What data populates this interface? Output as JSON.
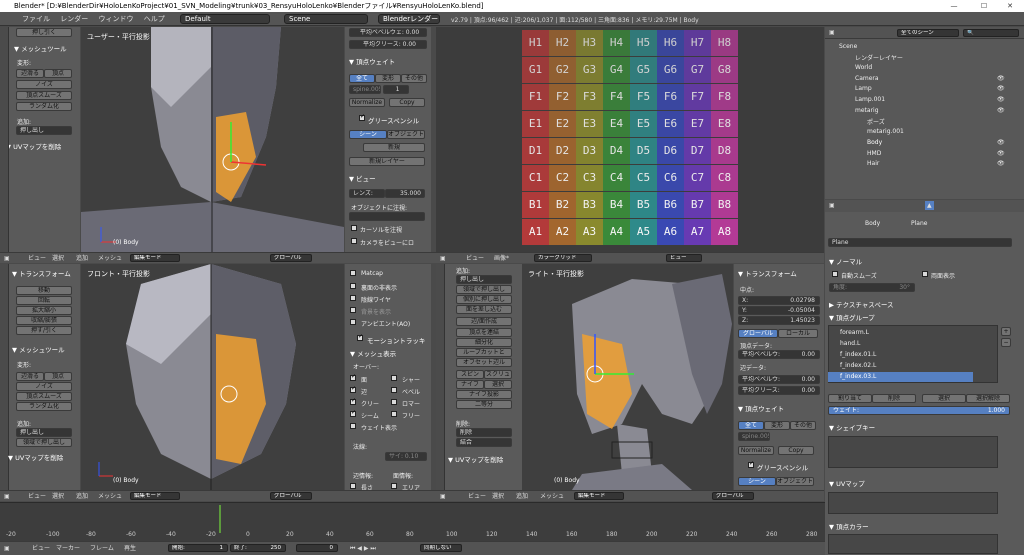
{
  "titlebar": {
    "title": "Blender* [D:¥BlenderDir¥HoloLenKoProject¥01_SVN_Modeling¥trunk¥03_RensyuHoloLenko¥Blenderファイル¥RensyuHoloLenKo.blend]"
  },
  "infobar": {
    "menus": [
      "ファイル",
      "レンダー",
      "ウィンドウ",
      "ヘルプ"
    ],
    "layout": "Default",
    "scene": "Scene",
    "engine": "Blenderレンダー",
    "stats": "v2.79 | 頂点:96/462 | 辺:206/1,037 | 面:112/580 | 三角面:836 | メモリ:29.75M | Body"
  },
  "topleft": {
    "label": "ユーザー・平行投影",
    "body": "(0) Body",
    "tools": {
      "top_btn": "押し引く",
      "mesh_tools": "▼ メッシュツール",
      "deform": "変形:",
      "slide_vert": "辺滑る",
      "vertex": "頂点",
      "noise": "ノイズ",
      "vsmooth": "頂点スムーズ",
      "randomize": "ランダム化",
      "add": "追加:",
      "extrude": "押し出し",
      "uv_remove": "▼ UVマップを削除"
    },
    "props": {
      "avg_bevel": "平均ベベルウェ: 0.00",
      "avg_crease": "平均クリース: 0.00",
      "vweight": "▼ 頂点ウェイト",
      "all": "全て",
      "deform": "変形",
      "other": "その他",
      "spine": "spine.005",
      "one": "1",
      "normalize": "Normalize",
      "copy": "Copy",
      "grease": "グリースペンシル",
      "scene": "シーン",
      "object": "オブジェクト",
      "new": "新規",
      "new_layer": "新規レイヤー",
      "view": "▼ ビュー",
      "lens": "レンズ:",
      "lens_val": "35.000",
      "look_obj": "オブジェクトに注視:",
      "cursor_lock": "カーソルを注視",
      "camera_view": "カメラをビューにロ"
    }
  },
  "uv": {
    "rows": [
      [
        "H1",
        "H2",
        "H3",
        "H4",
        "H5",
        "H6",
        "H7",
        "H8"
      ],
      [
        "G1",
        "G2",
        "G3",
        "G4",
        "G5",
        "G6",
        "G7",
        "G8"
      ],
      [
        "F1",
        "F2",
        "F3",
        "F4",
        "F5",
        "F6",
        "F7",
        "F8"
      ],
      [
        "E1",
        "E2",
        "E3",
        "E4",
        "E5",
        "E6",
        "E7",
        "E8"
      ],
      [
        "D1",
        "D2",
        "D3",
        "D4",
        "D5",
        "D6",
        "D7",
        "D8"
      ],
      [
        "C1",
        "C2",
        "C3",
        "C4",
        "C5",
        "C6",
        "C7",
        "C8"
      ],
      [
        "B1",
        "B2",
        "B3",
        "B4",
        "B5",
        "B6",
        "B7",
        "B8"
      ],
      [
        "A1",
        "A2",
        "A3",
        "A4",
        "A5",
        "A6",
        "A7",
        "A8"
      ]
    ],
    "header": {
      "view": "ビュー",
      "image": "画像*",
      "grid": "カラーグリッド",
      "view2": "ビュー"
    }
  },
  "outliner": {
    "search": "全てのシーン",
    "items": [
      "Scene",
      "レンダーレイヤー",
      "World",
      "Camera",
      "Lamp",
      "Lamp.001",
      "metarig",
      "ポーズ",
      "metarig.001",
      "Body",
      "HMD",
      "Hair"
    ]
  },
  "header_bottom": {
    "view": "ビュー",
    "select": "選択",
    "add": "追加",
    "mesh": "メッシュ",
    "mode": "編集モード",
    "global": "グローバル"
  },
  "botleft": {
    "label": "フロント・平行投影",
    "body": "(0) Body",
    "tools": {
      "transform": "▼ トランスフォーム",
      "move": "移動",
      "rotate": "回転",
      "scale": "拡大縮小",
      "mirror": "収縮/膨張",
      "push": "押す/引く",
      "mesh_tools": "▼ メッシュツール",
      "deform": "変形:",
      "slide": "辺滑る",
      "vertex": "頂点",
      "noise": "ノイズ",
      "vsmooth": "頂点スムーズ",
      "randomize": "ランダム化",
      "add": "追加:",
      "extrude": "押し出し",
      "extrude_normal": "領域で押し出し",
      "uv_remove": "▼ UVマップを削除"
    },
    "props": {
      "matcap": "Matcap",
      "backface": "裏面の非表示",
      "wire": "陰線ワイヤ",
      "world_bg": "背景を表示",
      "ao": "アンビエント(AO)",
      "motion": "モーショントラッキ",
      "mesh_display": "▼ メッシュ表示",
      "overlay": "オーバー:",
      "face": "面",
      "edge": "辺",
      "crease": "クリー",
      "seam": "シーム",
      "sharp": "シャー",
      "bevel": "ベベル",
      "mark": "ロマー",
      "freestyle": "フリー",
      "weight": "ウェイト表示",
      "normal": "法線:",
      "size": "サイ: 0.10",
      "edge_info": "辺情報:",
      "face_info": "面情報:",
      "length": "長さ",
      "area": "エリア"
    }
  },
  "midtools": {
    "add": "追加:",
    "extrude": "押し出し",
    "extrude_region": "領域で押し出し",
    "extrude_indiv": "個別に押し出し",
    "inset": "面を差し込む",
    "grid_fill": "辺/面作成",
    "knife": "頂点を連結",
    "bridge": "細分化",
    "loopcut": "ループカットと",
    "offset": "オフセット辺ル",
    "spin": "スピン",
    "screw": "スクリュ",
    "knife2": "ナイフ",
    "select": "選択",
    "knife_proj": "ナイフ投影",
    "bisect": "二等分",
    "delete": "削除:",
    "delete_btn": "削除",
    "join": "結合"
  },
  "botright": {
    "label": "ライト・平行投影",
    "body": "(0) Body",
    "props": {
      "transform": "▼ トランスフォーム",
      "median": "中点:",
      "x": "X:",
      "x_val": "0.02798",
      "y": "Y:",
      "y_val": "-0.05004",
      "z": "Z:",
      "z_val": "1.45023",
      "global": "グローバル",
      "local": "ローカル",
      "vdata": "頂点データ:",
      "avg_bevel": "平均ベベルウ:",
      "edge_data": "辺データ:",
      "avg_bevel2": "平均ベベルウ:",
      "avg_crease": "平均クリース:",
      "val0": "0.00",
      "vweight": "▼ 頂点ウェイト",
      "all": "全て",
      "deform": "変形",
      "other": "その他",
      "spine": "spine.005",
      "normalize": "Normalize",
      "copy": "Copy",
      "grease": "グリースペンシル",
      "scene": "シーン",
      "object": "オブジェクト"
    }
  },
  "properties": {
    "body": "Body",
    "plane": "Plane",
    "plane_field": "Plane",
    "normal": "▼ ノーマル",
    "autosmooth": "自動スムーズ",
    "double": "両面表示",
    "angle": "角度:",
    "angle_val": "30°",
    "texspace": "▶ テクスチャスペース",
    "vgroups": "▼ 頂点グループ",
    "groups": [
      "forearm.L",
      "hand.L",
      "f_index.01.L",
      "f_index.02.L",
      "f_index.03.L"
    ],
    "assign": "割り当て",
    "remove": "削除",
    "select": "選択",
    "deselect": "選択解除",
    "weight": "ウェイト:",
    "weight_val": "1.000",
    "shapekeys": "▼ シェイプキー",
    "uvmap": "▼ UVマップ",
    "vcolor": "▼ 頂点カラー"
  },
  "timeline": {
    "ticks": [
      "-20",
      "-100",
      "-80",
      "-60",
      "-40",
      "-20",
      "0",
      "20",
      "40",
      "60",
      "80",
      "100",
      "120",
      "140",
      "160",
      "180",
      "200",
      "220",
      "240",
      "260",
      "280"
    ],
    "view": "ビュー",
    "marker": "マーカー",
    "frame": "フレーム",
    "play": "再生",
    "start": "開始:",
    "start_val": "1",
    "end": "終了:",
    "end_val": "250",
    "cur": "0",
    "sync": "同期しない"
  },
  "colors": {
    "bg": "#4a4a4a",
    "panel": "#5a5a5a",
    "viewport": "#3f3f3f",
    "accent": "#5680c2"
  }
}
